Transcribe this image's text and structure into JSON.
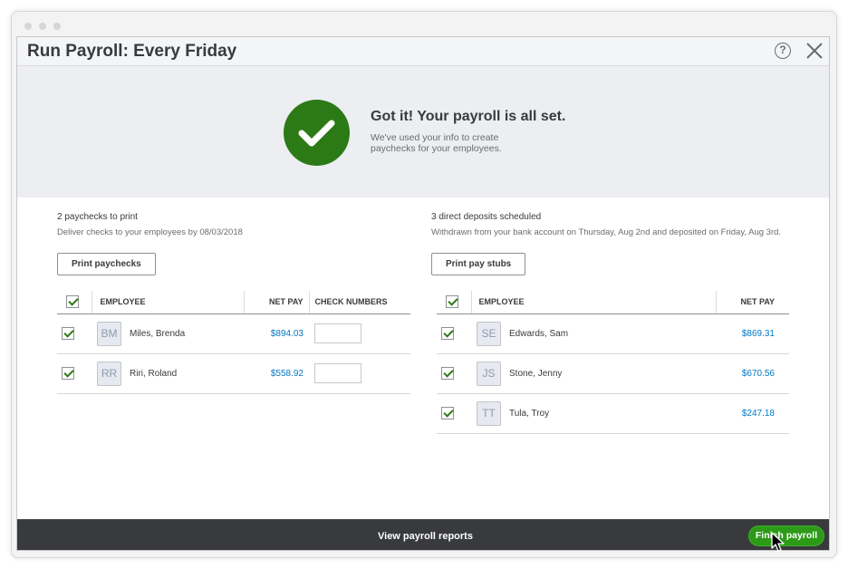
{
  "window": {
    "title": "Run Payroll: Every Friday",
    "help_label": "?"
  },
  "hero": {
    "title": "Got it! Your payroll is all set.",
    "subtitle": "We've used your info to create paychecks for your employees."
  },
  "left": {
    "info_title": "2 paychecks to print",
    "info_detail": "Deliver checks to your employees by 08/03/2018",
    "button_label": "Print paychecks",
    "columns": [
      "EMPLOYEE",
      "NET PAY",
      "CHECK NUMBERS"
    ],
    "rows": [
      {
        "initials": "BM",
        "name": "Miles, Brenda",
        "net_pay": "$894.03"
      },
      {
        "initials": "RR",
        "name": "Riri, Roland",
        "net_pay": "$558.92"
      }
    ]
  },
  "right": {
    "info_title": "3 direct deposits scheduled",
    "info_detail": "Withdrawn from your bank account on Thursday, Aug 2nd and deposited on Friday, Aug 3rd.",
    "button_label": "Print pay stubs",
    "columns": [
      "EMPLOYEE",
      "NET PAY"
    ],
    "rows": [
      {
        "initials": "SE",
        "name": "Edwards, Sam",
        "net_pay": "$869.31"
      },
      {
        "initials": "JS",
        "name": "Stone, Jenny",
        "net_pay": "$670.56"
      },
      {
        "initials": "TT",
        "name": "Tula, Troy",
        "net_pay": "$247.18"
      }
    ]
  },
  "footer": {
    "view_reports_label": "View payroll reports",
    "finish_label": "Finish payroll"
  },
  "colors": {
    "brand_green": "#2c7a16",
    "link_blue": "#0077c5",
    "footer_bg": "#393a3d"
  }
}
